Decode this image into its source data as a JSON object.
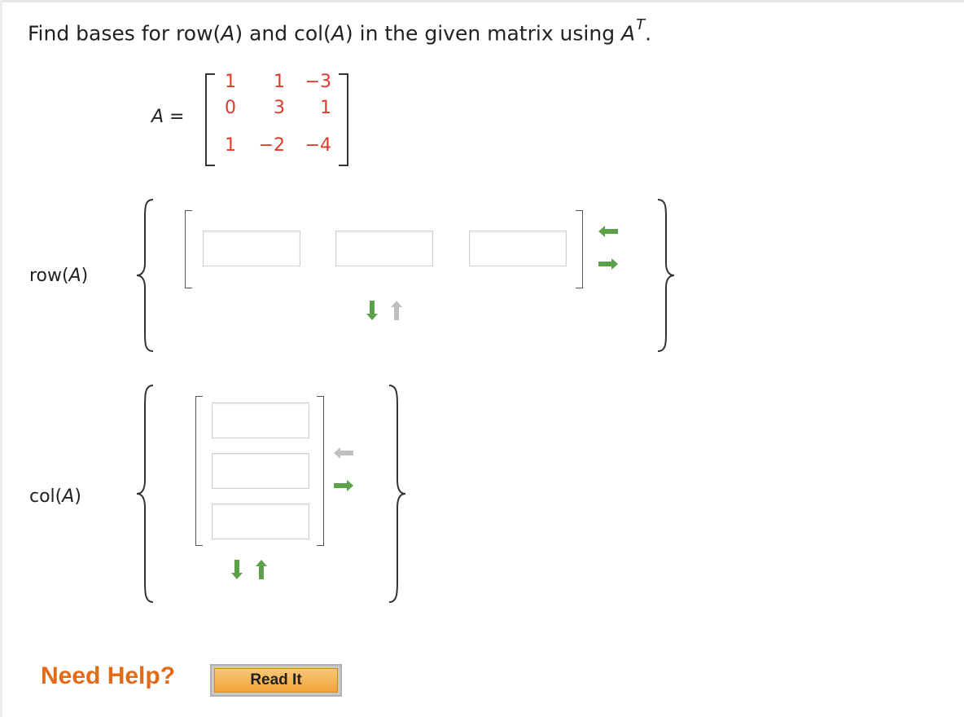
{
  "question": {
    "prefix": "Find bases for row(",
    "var1": "A",
    "mid": ") and col(",
    "var2": "A",
    "suffix": ") in the given matrix using ",
    "var3": "A",
    "sup": "T",
    "end": "."
  },
  "matrix": {
    "label_var": "A",
    "label_eq": " =",
    "rows": [
      [
        "1",
        "1",
        "−3"
      ],
      [
        "0",
        "3",
        "1"
      ],
      [
        "1",
        "−2",
        "−4"
      ]
    ],
    "value_color": "#e23a2a"
  },
  "row_section": {
    "label_pre": "row(",
    "label_var": "A",
    "label_post": ")",
    "inputs": [
      "",
      "",
      ""
    ]
  },
  "col_section": {
    "label_pre": "col(",
    "label_var": "A",
    "label_post": ")",
    "inputs": [
      "",
      "",
      ""
    ]
  },
  "icons": {
    "active_arrow_color": "#5aa14a",
    "inactive_arrow_color": "#bfbfbf"
  },
  "help": {
    "label": "Need Help?",
    "button": "Read It",
    "label_color": "#e36a17"
  }
}
